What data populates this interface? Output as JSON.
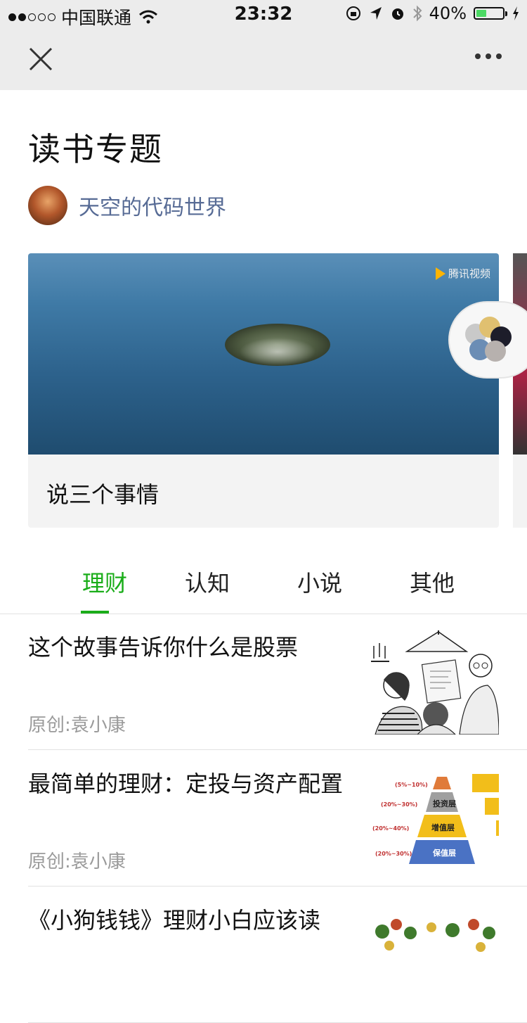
{
  "status_bar": {
    "carrier": "中国联通",
    "time": "23:32",
    "battery": "40%",
    "battery_level": 0.4,
    "icons": [
      "signal-dots-icon",
      "wifi-icon",
      "orientation-lock-icon",
      "location-icon",
      "alarm-icon",
      "bluetooth-icon",
      "battery-icon",
      "charging-icon"
    ]
  },
  "nav": {
    "close_icon": "close-icon",
    "more_icon": "more-icon"
  },
  "page": {
    "title": "读书专题",
    "author": "天空的代码世界"
  },
  "featured": {
    "title": "说三个事情",
    "watermark": "腾讯视频"
  },
  "tabs": [
    {
      "label": "理财",
      "active": true
    },
    {
      "label": "认知",
      "active": false
    },
    {
      "label": "小说",
      "active": false
    },
    {
      "label": "其他",
      "active": false
    }
  ],
  "articles": [
    {
      "title": "这个故事告诉你什么是股票",
      "meta": "原创:袁小康",
      "thumb": "cartoon-illustration"
    },
    {
      "title": "最简单的理财：定投与资产配置",
      "meta": "原创:袁小康",
      "thumb": "pyramid-chart",
      "thumb_labels": [
        "(5%~10%)",
        "(20%~30%)",
        "投资层",
        "(20%~40%)",
        "增值层",
        "(20%~30%)",
        "保值层"
      ]
    },
    {
      "title": "《小狗钱钱》理财小白应该读",
      "meta": "",
      "thumb": "floral-illustration"
    }
  ],
  "colors": {
    "accent": "#1aad19",
    "link": "#576b95",
    "meta": "#9a9a9a"
  }
}
